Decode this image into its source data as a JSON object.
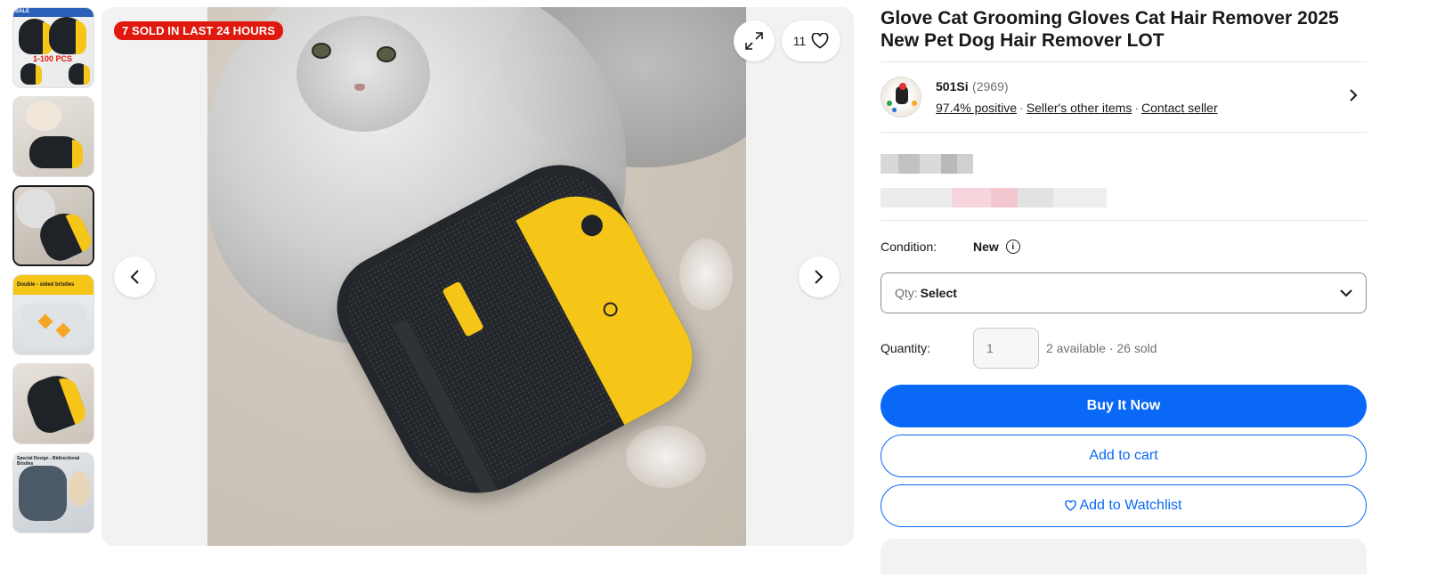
{
  "gallery": {
    "thumbnails": [
      {
        "label": "SALE",
        "caption": "1-100 PCS"
      },
      {
        "label": "",
        "caption": ""
      },
      {
        "label": "",
        "caption": ""
      },
      {
        "label": "Double - sided bristles",
        "caption": ""
      },
      {
        "label": "",
        "caption": ""
      },
      {
        "label": "Special Design - Bidirectional Bristles",
        "caption": ""
      }
    ],
    "active_index": 2,
    "sold_badge": "7 SOLD IN LAST 24 HOURS",
    "watch_count": "11"
  },
  "listing": {
    "title": "Glove Cat Grooming Gloves Cat Hair Remover 2025 New Pet Dog Hair Remover LOT"
  },
  "seller": {
    "name": "501Si",
    "feedback_count": "(2969)",
    "positive": "97.4% positive",
    "other_items": "Seller's other items",
    "contact": "Contact seller",
    "separator": "·"
  },
  "purchase": {
    "condition_label": "Condition:",
    "condition_value": "New",
    "qty_select_label": "Qty:",
    "qty_select_value": "Select",
    "quantity_label": "Quantity:",
    "quantity_placeholder": "1",
    "availability": "2 available · 26 sold",
    "buy_now": "Buy It Now",
    "add_to_cart": "Add to cart",
    "add_to_watchlist": "Add to Watchlist"
  },
  "colors": {
    "brand_blue": "#0968f6",
    "badge_red": "#e0190e"
  }
}
